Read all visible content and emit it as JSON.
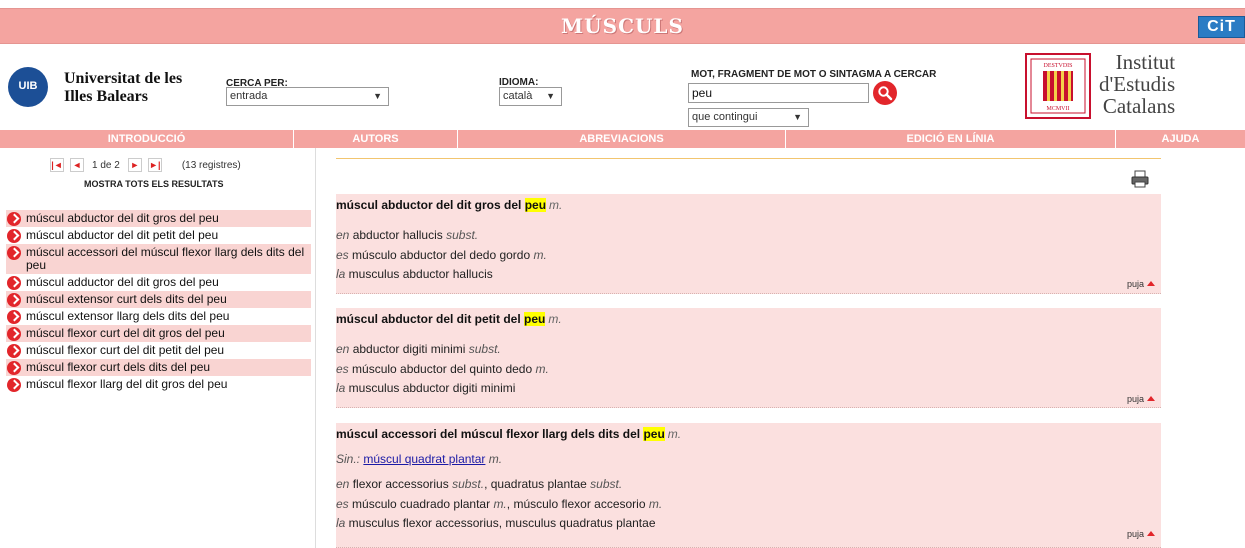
{
  "page": {
    "title": "MÚSCULS",
    "cit_logo": "CiT"
  },
  "header": {
    "uib_logo_text": "UIB",
    "uib_name_1": "Universitat de les",
    "uib_name_2": "Illes Balears",
    "cerca_label": "CERCA PER:",
    "cerca_value": "entrada",
    "idioma_label": "IDIOMA:",
    "idioma_value": "català",
    "mot_label": "MOT, FRAGMENT DE MOT O SINTAGMA A CERCAR",
    "mot_value": "peu",
    "match_value": "que contingui",
    "iec_line1": "Institut",
    "iec_line2": "d'Estudis",
    "iec_line3": "Catalans"
  },
  "nav": [
    "INTRODUCCIÓ",
    "AUTORS",
    "ABREVIACIONS",
    "EDICIÓ EN LÍNIA",
    "AJUDA"
  ],
  "pager": {
    "first": "K",
    "prev": "◄",
    "page": "1 de 2",
    "next": "►",
    "last": "►|",
    "count": "(13 registres)"
  },
  "show_all": "MOSTRA TOTS ELS RESULTATS",
  "results": [
    "múscul abductor del dit gros del peu",
    "múscul abductor del dit petit del peu",
    "múscul accessori del múscul flexor llarg dels dits del peu",
    "múscul adductor del dit gros del peu",
    "múscul extensor curt dels dits del peu",
    "múscul extensor llarg dels dits del peu",
    "múscul flexor curt del dit gros del peu",
    "múscul flexor curt del dit petit del peu",
    "múscul flexor curt dels dits del peu",
    "múscul flexor llarg del dit gros del peu"
  ],
  "entries": [
    {
      "head_pre": "múscul abductor del dit gros del ",
      "head_hl": "peu",
      "gender": "m.",
      "en_code": "en",
      "en_text": " abductor hallucis ",
      "en_pos": "subst.",
      "es_code": "es",
      "es_text": " músculo abductor del dedo gordo ",
      "es_pos": "m.",
      "la_code": "la",
      "la_text": " musculus abductor hallucis",
      "puja": "puja"
    },
    {
      "head_pre": "múscul abductor del dit petit del ",
      "head_hl": "peu",
      "gender": "m.",
      "en_code": "en",
      "en_text": " abductor digiti minimi ",
      "en_pos": "subst.",
      "es_code": "es",
      "es_text": " músculo abductor del quinto dedo ",
      "es_pos": "m.",
      "la_code": "la",
      "la_text": " musculus abductor digiti minimi",
      "puja": "puja"
    },
    {
      "head_pre": "múscul accessori del múscul flexor llarg dels dits del ",
      "head_hl": "peu",
      "gender": "m.",
      "sin_label": "Sin.:",
      "sin_link": "múscul quadrat plantar",
      "sin_pos": "m.",
      "en_code": "en",
      "en_text": " flexor accessorius ",
      "en_pos": "subst.",
      "en_text2": ", quadratus plantae ",
      "en_pos2": "subst.",
      "es_code": "es",
      "es_text": " músculo cuadrado plantar ",
      "es_pos": "m.",
      "es_text2": ", músculo flexor accesorio ",
      "es_pos2": "m.",
      "la_code": "la",
      "la_text": " musculus flexor accessorius, musculus quadratus plantae",
      "puja": "puja"
    }
  ],
  "colors": {
    "band": "#f4a4a0",
    "row_alt": "#f9d4d2",
    "entry_bg": "#fbe0df",
    "accent": "#e2262b",
    "highlight": "#ffff00"
  }
}
